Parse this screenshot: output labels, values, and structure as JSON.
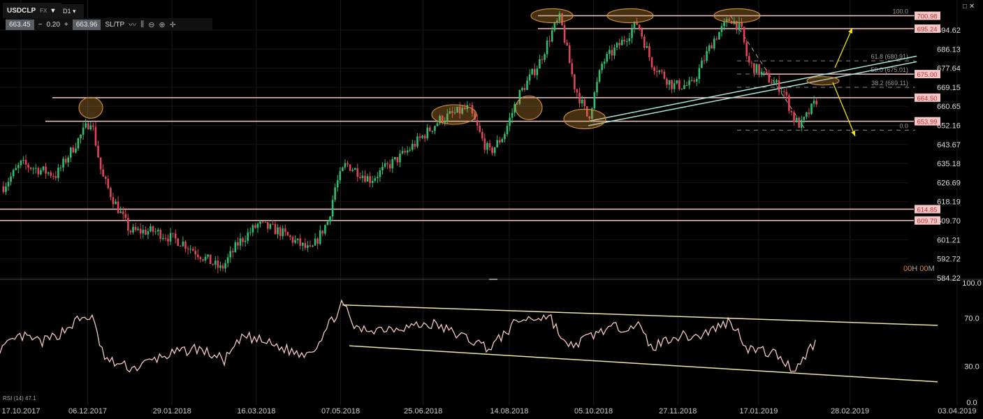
{
  "header": {
    "symbol": "USDCLP",
    "market": "FX",
    "timeframe": "D1",
    "bid": "663.45",
    "spread_minus": "−",
    "change": "0.20",
    "spread_plus": "+",
    "ask": "663.96",
    "sltp": "SL/TP",
    "window_controls": "□ ✕"
  },
  "timer": {
    "h": "00",
    "h_unit": "H",
    "m": "00",
    "m_unit": "M"
  },
  "rsi_label": "RSI (14) 47.1",
  "colors": {
    "up": "#2fbf71",
    "down": "#e0455a",
    "level": "#f4c6c6",
    "fib": "#888888",
    "trend": "#a8e6d9",
    "arrow": "#f2e600",
    "ellipse": "#c88a3a",
    "rsi": "#f3c9c2",
    "rsi_channel": "#ede7a6"
  },
  "chart_data": [
    {
      "type": "candlestick",
      "title": "USDCLP D1",
      "x_unit": "days since 17.10.2017",
      "xlim": [
        -12,
        533
      ],
      "ylim": [
        584.22,
        703
      ],
      "price_path": [
        [
          -10,
          625
        ],
        [
          0,
          635
        ],
        [
          20,
          630
        ],
        [
          28,
          640
        ],
        [
          40,
          655
        ],
        [
          46,
          630
        ],
        [
          52,
          620
        ],
        [
          62,
          605
        ],
        [
          76,
          605
        ],
        [
          92,
          600
        ],
        [
          114,
          588
        ],
        [
          124,
          600
        ],
        [
          135,
          608
        ],
        [
          147,
          605
        ],
        [
          165,
          596
        ],
        [
          175,
          610
        ],
        [
          179,
          625
        ],
        [
          185,
          635
        ],
        [
          199,
          628
        ],
        [
          219,
          640
        ],
        [
          239,
          655
        ],
        [
          255,
          660
        ],
        [
          263,
          645
        ],
        [
          267,
          640
        ],
        [
          275,
          648
        ],
        [
          283,
          665
        ],
        [
          295,
          680
        ],
        [
          303,
          695
        ],
        [
          307,
          700
        ],
        [
          315,
          670
        ],
        [
          323,
          655
        ],
        [
          331,
          680
        ],
        [
          343,
          690
        ],
        [
          351,
          698
        ],
        [
          359,
          680
        ],
        [
          371,
          670
        ],
        [
          382,
          670
        ],
        [
          394,
          690
        ],
        [
          404,
          700
        ],
        [
          410,
          695
        ],
        [
          414,
          680
        ],
        [
          422,
          675
        ],
        [
          434,
          668
        ],
        [
          440,
          655
        ],
        [
          444,
          652
        ],
        [
          452,
          662
        ],
        [
          454,
          665
        ]
      ],
      "y_ticks": [
        "694.62",
        "686.13",
        "677.64",
        "669.15",
        "660.65",
        "652.16",
        "643.67",
        "635.18",
        "626.69",
        "618.19",
        "609.70",
        "601.21",
        "592.72",
        "584.22"
      ],
      "x_ticks": [
        {
          "d": 0,
          "label": "17.10.2017"
        },
        {
          "d": 38,
          "label": "06.12.2017"
        },
        {
          "d": 86,
          "label": "29.01.2018"
        },
        {
          "d": 134,
          "label": "16.03.2018"
        },
        {
          "d": 182,
          "label": "07.05.2018"
        },
        {
          "d": 229,
          "label": "25.06.2018"
        },
        {
          "d": 278,
          "label": "14.08.2018"
        },
        {
          "d": 326,
          "label": "05.10.2018"
        },
        {
          "d": 374,
          "label": "27.11.2018"
        },
        {
          "d": 420,
          "label": "17.01.2019"
        },
        {
          "d": 472,
          "label": "28.02.2019"
        },
        {
          "d": 533,
          "label": "03.04.2019"
        }
      ],
      "levels": [
        {
          "price": 700.98,
          "label": "700.98"
        },
        {
          "price": 695.24,
          "label": "695.24"
        },
        {
          "price": 675.0,
          "label": "675.00"
        },
        {
          "price": 664.5,
          "label": "664.50"
        },
        {
          "price": 653.99,
          "label": "653.99"
        },
        {
          "price": 614.85,
          "label": "614.85"
        },
        {
          "price": 609.79,
          "label": "609.79"
        }
      ],
      "fibonacci": [
        {
          "price": 700.98,
          "label": "100.0"
        },
        {
          "price": 680.91,
          "label": "61.8 (680.91)"
        },
        {
          "price": 675.01,
          "label": "50.0 (675.01)"
        },
        {
          "price": 669.11,
          "label": "38.2 (669.11)"
        },
        {
          "price": 650.01,
          "label": "0.0"
        }
      ]
    },
    {
      "type": "line",
      "title": "RSI (14)",
      "ylim": [
        0,
        100
      ],
      "y_ticks": [
        "100.0",
        "70.0",
        "30.0",
        "0.0"
      ],
      "values": [
        [
          -10,
          45
        ],
        [
          0,
          55
        ],
        [
          12,
          50
        ],
        [
          20,
          55
        ],
        [
          32,
          68
        ],
        [
          40,
          72
        ],
        [
          48,
          35
        ],
        [
          64,
          28
        ],
        [
          80,
          38
        ],
        [
          100,
          45
        ],
        [
          116,
          35
        ],
        [
          127,
          55
        ],
        [
          139,
          50
        ],
        [
          159,
          40
        ],
        [
          167,
          45
        ],
        [
          183,
          82
        ],
        [
          191,
          60
        ],
        [
          211,
          62
        ],
        [
          235,
          65
        ],
        [
          251,
          55
        ],
        [
          267,
          45
        ],
        [
          283,
          68
        ],
        [
          301,
          72
        ],
        [
          311,
          45
        ],
        [
          331,
          60
        ],
        [
          351,
          65
        ],
        [
          359,
          45
        ],
        [
          371,
          55
        ],
        [
          386,
          55
        ],
        [
          404,
          68
        ],
        [
          414,
          45
        ],
        [
          430,
          40
        ],
        [
          440,
          27
        ],
        [
          446,
          38
        ],
        [
          453,
          52
        ]
      ],
      "channel": [
        {
          "from": [
            183,
            81
          ],
          "to": [
            533,
            64
          ]
        },
        {
          "from": [
            187,
            47
          ],
          "to": [
            533,
            17
          ]
        }
      ]
    }
  ]
}
